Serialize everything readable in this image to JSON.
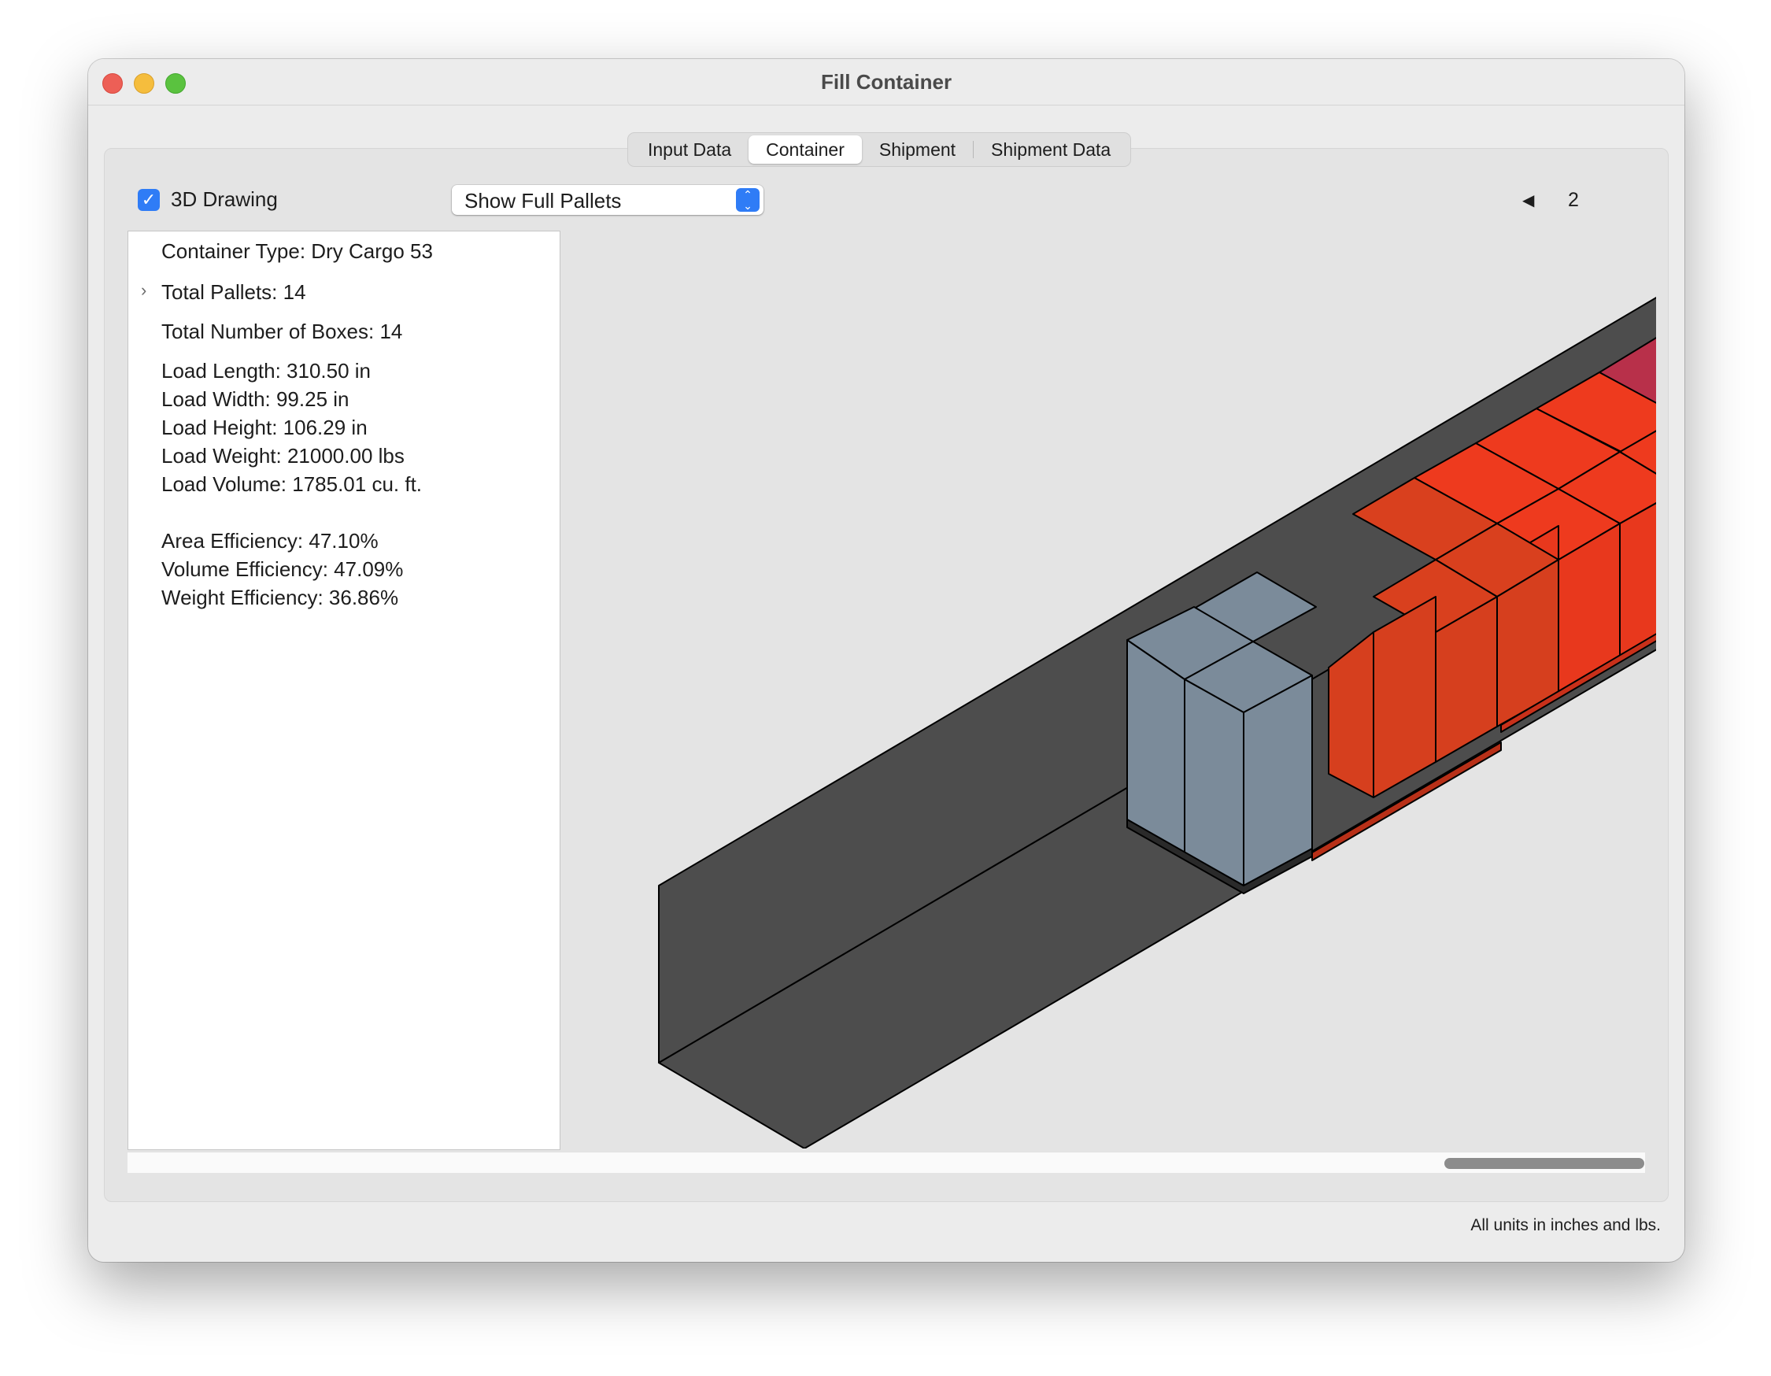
{
  "window": {
    "title": "Fill Container"
  },
  "tabs": [
    {
      "label": "Input Data"
    },
    {
      "label": "Container"
    },
    {
      "label": "Shipment"
    },
    {
      "label": "Shipment Data"
    }
  ],
  "active_tab": "Container",
  "toolbar": {
    "drawing_3d_label": "3D Drawing",
    "drawing_3d_checked": true,
    "view_select_value": "Show Full Pallets",
    "page_number": "2"
  },
  "info": {
    "container_type": "Container Type: Dry Cargo 53",
    "total_pallets": "Total Pallets: 14",
    "total_boxes": "Total Number of Boxes: 14",
    "load_length": "Load Length: 310.50 in",
    "load_width": "Load Width: 99.25 in",
    "load_height": "Load Height: 106.29 in",
    "load_weight": "Load Weight: 21000.00 lbs",
    "load_volume": "Load Volume: 1785.01 cu. ft.",
    "area_efficiency": "Area Efficiency: 47.10%",
    "volume_efficiency": "Volume Efficiency: 47.09%",
    "weight_efficiency": "Weight Efficiency: 36.86%"
  },
  "footer": {
    "units_note": "All units in inches and lbs."
  },
  "colors": {
    "container": "#4d4d4d",
    "pallet_gray": "#7b8b9a",
    "pallet_orange": "#d9401e",
    "pallet_red": "#ee3a1e",
    "pallet_crimson": "#b8304a"
  }
}
